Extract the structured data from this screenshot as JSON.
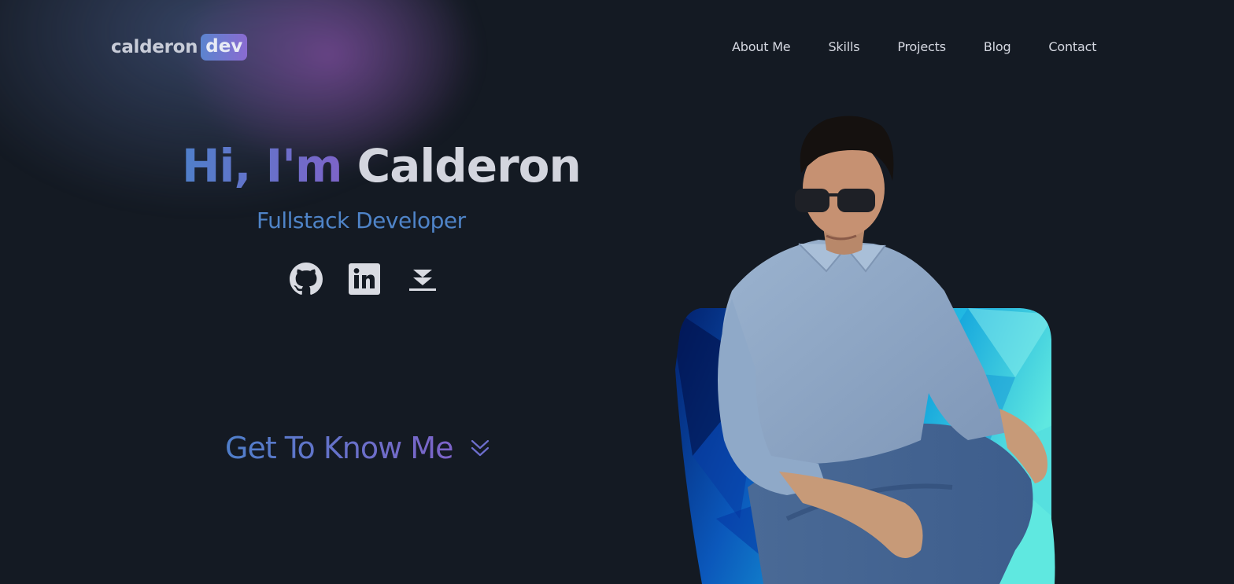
{
  "brand": {
    "name": "calderon",
    "badge": "dev"
  },
  "nav": {
    "items": [
      {
        "label": "About Me"
      },
      {
        "label": "Skills"
      },
      {
        "label": "Projects"
      },
      {
        "label": "Blog"
      },
      {
        "label": "Contact"
      }
    ]
  },
  "hero": {
    "greeting": "Hi, I'm",
    "name": "Calderon",
    "role": "Fullstack Developer",
    "socials": [
      {
        "icon": "github-icon"
      },
      {
        "icon": "linkedin-icon"
      },
      {
        "icon": "download-icon"
      }
    ],
    "cta_label": "Get To Know Me",
    "cta_icon": "chevron-double-down-icon"
  },
  "colors": {
    "background": "#141a23",
    "accent_blue": "#4f84c8",
    "accent_purple": "#7d64c9",
    "text_light": "#d3d5de"
  }
}
